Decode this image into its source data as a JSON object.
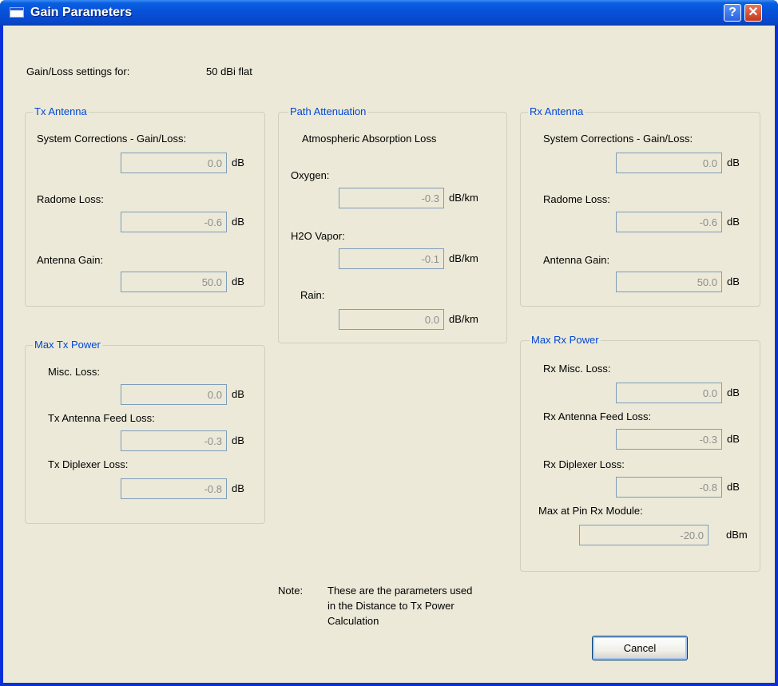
{
  "window": {
    "title": "Gain Parameters",
    "help_glyph": "?",
    "close_glyph": "✕"
  },
  "header": {
    "label": "Gain/Loss settings for:",
    "value": "50 dBi flat"
  },
  "tx_antenna": {
    "title": "Tx Antenna",
    "system_corrections_label": "System Corrections - Gain/Loss:",
    "system_corrections_value": "0.0",
    "system_corrections_unit": "dB",
    "radome_loss_label": "Radome Loss:",
    "radome_loss_value": "-0.6",
    "radome_loss_unit": "dB",
    "antenna_gain_label": "Antenna Gain:",
    "antenna_gain_value": "50.0",
    "antenna_gain_unit": "dB"
  },
  "path_attenuation": {
    "title": "Path Attenuation",
    "subtitle": "Atmospheric Absorption Loss",
    "oxygen_label": "Oxygen:",
    "oxygen_value": "-0.3",
    "oxygen_unit": "dB/km",
    "h2o_label": "H2O Vapor:",
    "h2o_value": "-0.1",
    "h2o_unit": "dB/km",
    "rain_label": "Rain:",
    "rain_value": "0.0",
    "rain_unit": "dB/km"
  },
  "rx_antenna": {
    "title": "Rx Antenna",
    "system_corrections_label": "System Corrections - Gain/Loss:",
    "system_corrections_value": "0.0",
    "system_corrections_unit": "dB",
    "radome_loss_label": "Radome Loss:",
    "radome_loss_value": "-0.6",
    "radome_loss_unit": "dB",
    "antenna_gain_label": "Antenna Gain:",
    "antenna_gain_value": "50.0",
    "antenna_gain_unit": "dB"
  },
  "max_tx_power": {
    "title": "Max Tx Power",
    "misc_loss_label": "Misc. Loss:",
    "misc_loss_value": "0.0",
    "misc_loss_unit": "dB",
    "feed_loss_label": "Tx Antenna Feed Loss:",
    "feed_loss_value": "-0.3",
    "feed_loss_unit": "dB",
    "diplexer_loss_label": "Tx Diplexer Loss:",
    "diplexer_loss_value": "-0.8",
    "diplexer_loss_unit": "dB"
  },
  "max_rx_power": {
    "title": "Max Rx Power",
    "misc_loss_label": "Rx Misc. Loss:",
    "misc_loss_value": "0.0",
    "misc_loss_unit": "dB",
    "feed_loss_label": "Rx Antenna Feed Loss:",
    "feed_loss_value": "-0.3",
    "feed_loss_unit": "dB",
    "diplexer_loss_label": "Rx Diplexer Loss:",
    "diplexer_loss_value": "-0.8",
    "diplexer_loss_unit": "dB",
    "max_pin_label": "Max at Pin Rx Module:",
    "max_pin_value": "-20.0",
    "max_pin_unit": "dBm"
  },
  "note": {
    "label": "Note:",
    "line1": "These are the parameters used",
    "line2": "in the Distance to Tx Power",
    "line3": "Calculation"
  },
  "buttons": {
    "cancel": "Cancel"
  },
  "colors": {
    "titlebar": "#0751d9",
    "dialog_bg": "#ece9d8",
    "group_title": "#0046d5",
    "field_border": "#7f9db9"
  }
}
